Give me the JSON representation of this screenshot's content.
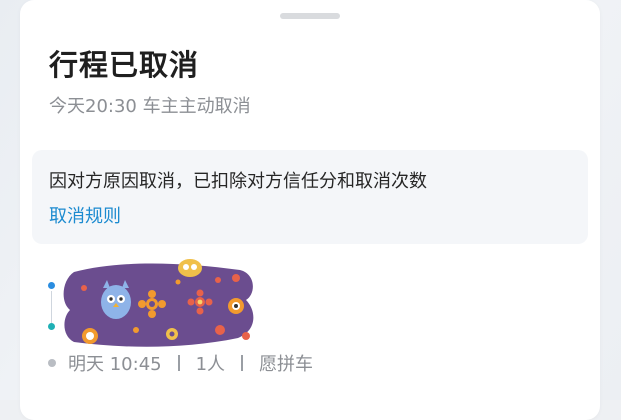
{
  "card": {
    "title": "行程已取消",
    "subtitle": "今天20:30 车主主动取消"
  },
  "notice": {
    "text": "因对方原因取消，已扣除对方信任分和取消次数",
    "link_label": "取消规则"
  },
  "trip": {
    "time": "明天 10:45",
    "people": "1人",
    "type": "愿拼车"
  },
  "colors": {
    "link": "#1c8bd0",
    "start_dot": "#2a8de0",
    "end_dot": "#1fb0b5",
    "sticker_bg": "#6b4d8f"
  },
  "icons": {
    "sticker": "purple-owl-sticker-redaction"
  }
}
